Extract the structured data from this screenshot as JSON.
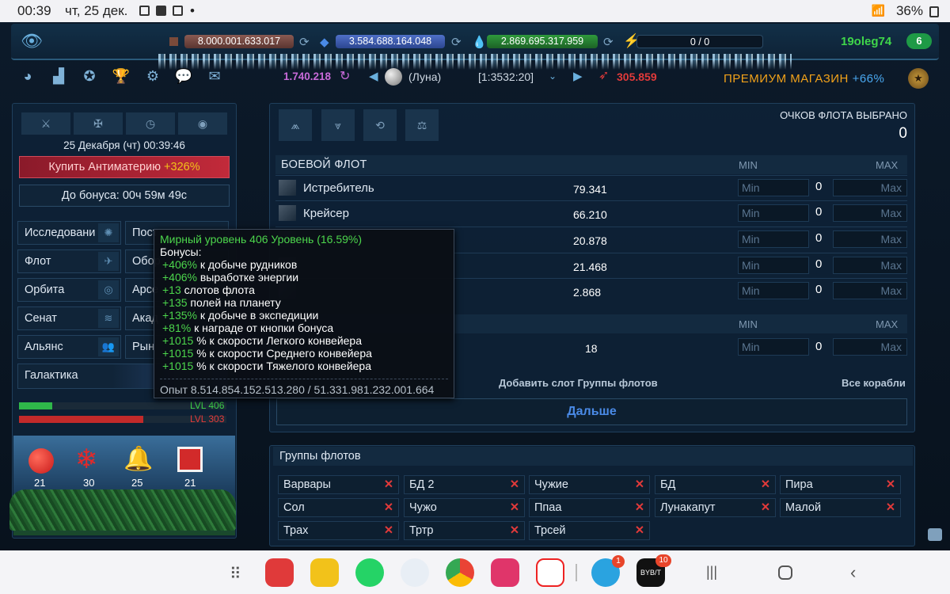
{
  "status_bar": {
    "time": "00:39",
    "date": "чт, 25 дек.",
    "dot": "•",
    "battery": "36%"
  },
  "resources": {
    "metal": "8.000.001.633.017",
    "crystal": "3.584.688.164.048",
    "deuterium": "2.869.695.317.959",
    "energy": "0 / 0"
  },
  "player": {
    "name": "19oleg74",
    "level": "6"
  },
  "nav": {
    "dark_matter": "1.740.218",
    "planet_name": "(Луна)",
    "coords": "[1:3532:20]",
    "points": "305.859",
    "premium_label": "ПРЕМИУМ МАГАЗИН",
    "premium_bonus": "+66%"
  },
  "sidebar": {
    "datetime": "25 Декабря (чт) 00:39:46",
    "antimatter_label": "Купить Антиматерию",
    "antimatter_bonus": "+326%",
    "bonus_timer": "До бонуса: 00ч 59м 49с",
    "menu_left": [
      "Исследовани",
      "Флот",
      "Орбита",
      "Сенат",
      "Альянс",
      "Галактика"
    ],
    "menu_right": [
      "Пост",
      "Обор",
      "Арсе",
      "Акад",
      "Рын"
    ],
    "lvl1": "LVL 406",
    "lvl2": "LVL 303",
    "lvl1_fill": 0.16,
    "lvl2_fill": 0.6,
    "gifts": [
      "21",
      "30",
      "25",
      "21"
    ]
  },
  "fleet": {
    "points_label": "ОЧКОВ ФЛОТА ВЫБРАНО",
    "points_value": "0",
    "combat_header": "БОЕВОЙ ФЛОТ",
    "min_h": "MIN",
    "max_h": "MAX",
    "ships": [
      {
        "name": "Истребитель",
        "count": "79.341",
        "value": "0"
      },
      {
        "name": "Крейсер",
        "count": "66.210",
        "value": "0"
      },
      {
        "name": "",
        "count": "20.878",
        "value": "0"
      },
      {
        "name": "",
        "count": "21.468",
        "value": "0"
      },
      {
        "name": "",
        "count": "2.868",
        "value": "0"
      }
    ],
    "civil": [
      {
        "count": "18",
        "value": "0"
      }
    ],
    "min_ph": "Min",
    "max_ph": "Max",
    "add_slot": "Добавить слот Группы флотов",
    "all_ships": "Все корабли",
    "next": "Дальше"
  },
  "groups": {
    "title": "Группы флотов",
    "items": [
      "Варвары",
      "БД 2",
      "Чужие",
      "БД",
      "Пира",
      "Сол",
      "Чужо",
      "Ппаа",
      "Лунакапут",
      "Малой",
      "Трах",
      "Тртр",
      "Трсей"
    ]
  },
  "tooltip": {
    "title": "Мирный уровень 406 Уровень (16.59%)",
    "subtitle": "Бонусы:",
    "bonuses": [
      {
        "v": "+406%",
        "t": " к добыче рудников"
      },
      {
        "v": "+406%",
        "t": " выработке энергии"
      },
      {
        "v": "+13",
        "t": " слотов флота"
      },
      {
        "v": "+135",
        "t": " полей на планету"
      },
      {
        "v": "+135%",
        "t": " к добыче в экспедиции"
      },
      {
        "v": "+81%",
        "t": " к награде от кнопки бонуса"
      },
      {
        "v": "+1015",
        "t": " % к скорости Легкого конвейера"
      },
      {
        "v": "+1015",
        "t": " % к скорости Среднего конвейера"
      },
      {
        "v": "+1015",
        "t": " % к скорости Тяжелого конвейера"
      }
    ],
    "exp": "Опыт 8.514.854.152.513.280 / 51.331.981.232.001.664"
  },
  "nav_apps": {
    "telegram_badge": "1",
    "bybit_label": "BYB/T",
    "bybit_badge": "10"
  },
  "colors": {
    "green": "#4cd64c",
    "red": "#e23a3a",
    "gold": "#f2a21a"
  }
}
